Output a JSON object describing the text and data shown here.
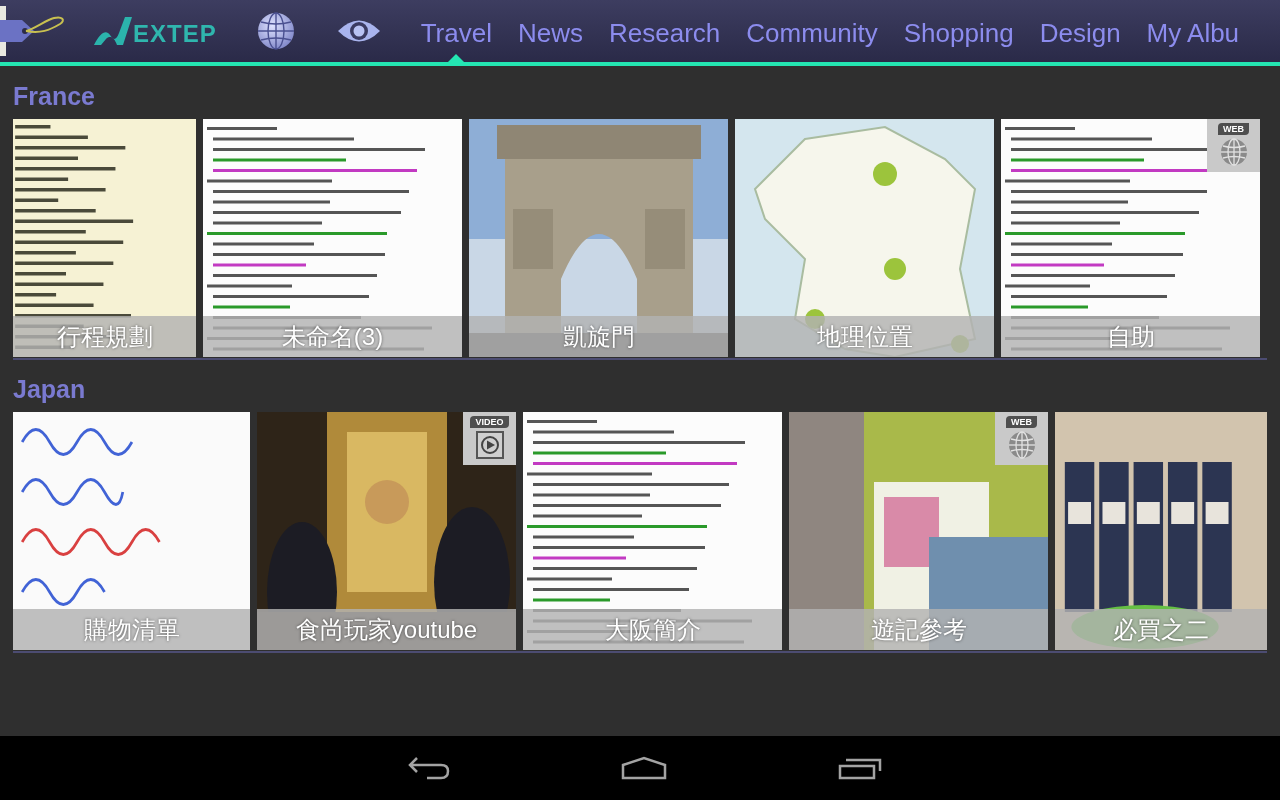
{
  "top_bar": {
    "logo": {
      "text": "EXTEP"
    },
    "tabs": [
      {
        "label": "Travel",
        "selected": true
      },
      {
        "label": "News",
        "selected": false
      },
      {
        "label": "Research",
        "selected": false
      },
      {
        "label": "Community",
        "selected": false
      },
      {
        "label": "Shopping",
        "selected": false
      },
      {
        "label": "Design",
        "selected": false
      },
      {
        "label": "My Albu",
        "selected": false
      }
    ]
  },
  "sections": [
    {
      "title": "France",
      "items": [
        {
          "caption": "行程規劃",
          "kind": "list"
        },
        {
          "caption": "未命名(3)",
          "kind": "document"
        },
        {
          "caption": "凱旋門",
          "kind": "landmark"
        },
        {
          "caption": "地理位置",
          "kind": "map"
        },
        {
          "caption": "自助",
          "kind": "document",
          "badge": {
            "kind": "web",
            "label": "WEB"
          }
        }
      ]
    },
    {
      "title": "Japan",
      "items": [
        {
          "caption": "購物清單",
          "kind": "note"
        },
        {
          "caption": "食尚玩家youtube",
          "kind": "video-frame",
          "badge": {
            "kind": "video",
            "label": "VIDEO"
          }
        },
        {
          "caption": "大阪簡介",
          "kind": "document"
        },
        {
          "caption": "遊記參考",
          "kind": "webpage",
          "badge": {
            "kind": "web",
            "label": "WEB"
          }
        },
        {
          "caption": "必買之二",
          "kind": "product-photo"
        }
      ]
    }
  ]
}
